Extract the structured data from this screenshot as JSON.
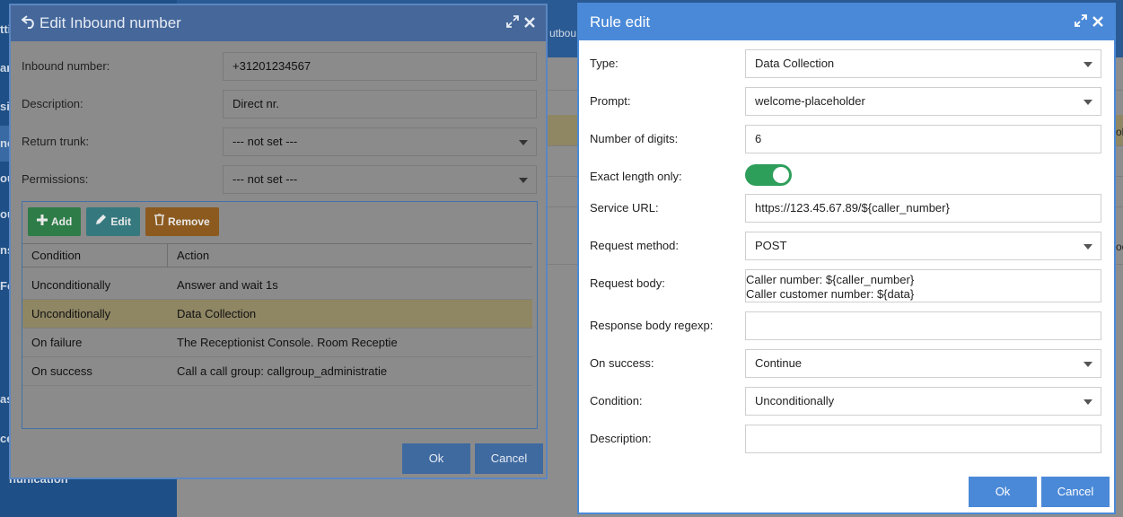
{
  "background": {
    "sidebar_items": [
      "ttin",
      "an",
      "si",
      "ne",
      "ou",
      "ou",
      "ns",
      "Fe",
      "as",
      "ce",
      "nunication"
    ],
    "top_tab": "utbou",
    "edge_texts": [
      "ol",
      "oo"
    ]
  },
  "inbound_dialog": {
    "title": "Edit Inbound number",
    "back_icon": "return-arrow-icon",
    "fields": {
      "inbound_number": {
        "label": "Inbound number:",
        "value": "+31201234567"
      },
      "description": {
        "label": "Description:",
        "value": "Direct nr."
      },
      "return_trunk": {
        "label": "Return trunk:",
        "value": "--- not set ---"
      },
      "permissions": {
        "label": "Permissions:",
        "value": "--- not set ---"
      }
    },
    "toolbar": {
      "add": "Add",
      "edit": "Edit",
      "remove": "Remove"
    },
    "grid": {
      "columns": [
        "Condition",
        "Action"
      ],
      "rows": [
        {
          "condition": "Unconditionally",
          "action": "Answer and wait 1s",
          "selected": false
        },
        {
          "condition": "Unconditionally",
          "action": "Data Collection",
          "selected": true
        },
        {
          "condition": "On failure",
          "action": "The Receptionist Console. Room Receptie",
          "selected": false
        },
        {
          "condition": "On success",
          "action": "Call a call group: callgroup_administratie",
          "selected": false
        }
      ]
    },
    "ok_label": "Ok",
    "cancel_label": "Cancel"
  },
  "rule_dialog": {
    "title": "Rule edit",
    "fields": {
      "type": {
        "label": "Type:",
        "value": "Data Collection"
      },
      "prompt": {
        "label": "Prompt:",
        "value": "welcome-placeholder"
      },
      "digits": {
        "label": "Number of digits:",
        "value": "6"
      },
      "exact_length": {
        "label": "Exact length only:",
        "on": true
      },
      "service_url": {
        "label": "Service URL:",
        "value": "https://123.45.67.89/${caller_number}"
      },
      "request_method": {
        "label": "Request method:",
        "value": "POST"
      },
      "request_body": {
        "label": "Request body:",
        "line1": "Caller number: ${caller_number}",
        "line2": "Caller customer number: ${data}"
      },
      "response_regexp": {
        "label": "Response body regexp:",
        "value": ""
      },
      "on_success": {
        "label": "On success:",
        "value": "Continue"
      },
      "condition": {
        "label": "Condition:",
        "value": "Unconditionally"
      },
      "description": {
        "label": "Description:",
        "value": ""
      }
    },
    "ok_label": "Ok",
    "cancel_label": "Cancel"
  },
  "colors": {
    "accent": "#4a89d8",
    "toggle_on": "#2e9e5b",
    "add": "#2e7d48",
    "edit": "#35797f",
    "remove": "#8c5a1e",
    "selected_row": "#8f8664"
  }
}
